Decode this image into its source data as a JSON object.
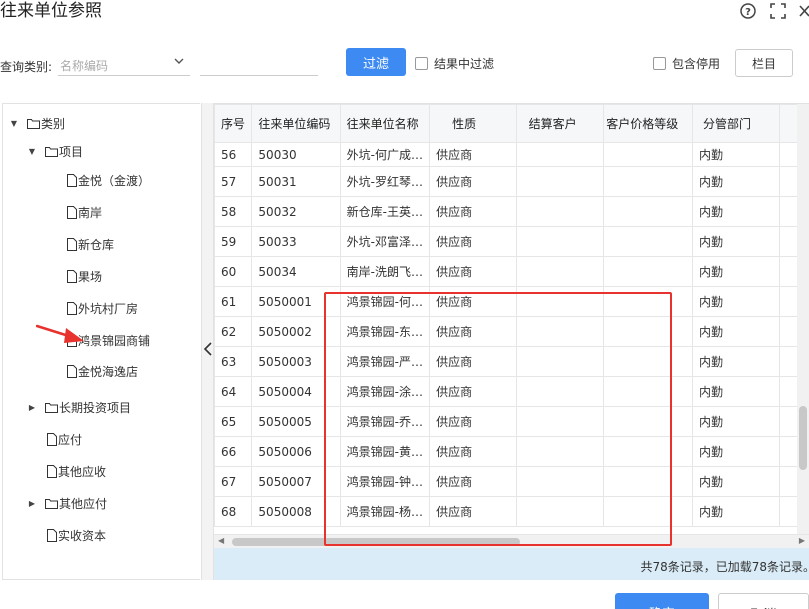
{
  "title": "往来单位参照",
  "query": {
    "label": "查询类别:",
    "select_placeholder": "名称编码",
    "input_value": "",
    "filter_button": "过滤",
    "filter_in_results": "结果中过滤",
    "include_disabled": "包含停用",
    "columns_button": "栏目"
  },
  "tree": {
    "root": "类别",
    "items": [
      {
        "label": "项目"
      },
      {
        "label": "金悦（金渡）"
      },
      {
        "label": "南岸"
      },
      {
        "label": "新仓库"
      },
      {
        "label": "果场"
      },
      {
        "label": "外坑村厂房"
      },
      {
        "label": "鸿景锦园商铺"
      },
      {
        "label": "金悦海逸店"
      },
      {
        "label": "长期投资项目"
      },
      {
        "label": "应付"
      },
      {
        "label": "其他应收"
      },
      {
        "label": "其他应付"
      },
      {
        "label": "实收资本"
      }
    ]
  },
  "grid": {
    "headers": [
      "序号",
      "往来单位编码",
      "往来单位名称",
      "性质",
      "结算客户",
      "客户价格等级",
      "分管部门",
      ""
    ],
    "rows": [
      [
        "56",
        "50030",
        "外坑-何广成…",
        "供应商",
        "",
        "",
        "内勤",
        " "
      ],
      [
        "57",
        "50031",
        "外坑-罗红琴…",
        "供应商",
        "",
        "",
        "内勤",
        " "
      ],
      [
        "58",
        "50032",
        "新仓库-王英…",
        "供应商",
        "",
        "",
        "内勤",
        " "
      ],
      [
        "59",
        "50033",
        "外坑-邓富泽…",
        "供应商",
        "",
        "",
        "内勤",
        " "
      ],
      [
        "60",
        "50034",
        "南岸-洗朗飞…",
        "供应商",
        "",
        "",
        "内勤",
        " "
      ],
      [
        "61",
        "5050001",
        "鸿景锦园-何…",
        "供应商",
        "",
        "",
        "内勤",
        " "
      ],
      [
        "62",
        "5050002",
        "鸿景锦园-东…",
        "供应商",
        "",
        "",
        "内勤",
        " "
      ],
      [
        "63",
        "5050003",
        "鸿景锦园-严…",
        "供应商",
        "",
        "",
        "内勤",
        " "
      ],
      [
        "64",
        "5050004",
        "鸿景锦园-涂…",
        "供应商",
        "",
        "",
        "内勤",
        " "
      ],
      [
        "65",
        "5050005",
        "鸿景锦园-乔…",
        "供应商",
        "",
        "",
        "内勤",
        " "
      ],
      [
        "66",
        "5050006",
        "鸿景锦园-黄…",
        "供应商",
        "",
        "",
        "内勤",
        " "
      ],
      [
        "67",
        "5050007",
        "鸿景锦园-钟…",
        "供应商",
        "",
        "",
        "内勤",
        " "
      ],
      [
        "68",
        "5050008",
        "鸿景锦园-杨…",
        "供应商",
        "",
        "",
        "内勤",
        " "
      ]
    ],
    "footer": "共78条记录，已加载78条记录。"
  },
  "buttons": {
    "ok": "确定",
    "cancel": "取消"
  },
  "colors": {
    "primary": "#3d8bf2",
    "annotation": "#e8322e",
    "footer_bg": "#d9ecf7"
  }
}
